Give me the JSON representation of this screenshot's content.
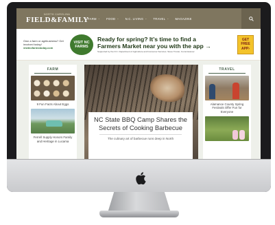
{
  "site": {
    "logo_top": "NORTH CAROLINA",
    "logo_main": "FIELD&FAMILY"
  },
  "nav": {
    "items": [
      {
        "label": "FARM",
        "caret": "⌄"
      },
      {
        "label": "FOOD",
        "caret": "⌄"
      },
      {
        "label": "N.C. LIVING",
        "caret": "⌄"
      },
      {
        "label": "TRAVEL",
        "caret": "⌄"
      },
      {
        "label": "MAGAZINE",
        "caret": ""
      }
    ],
    "search_icon": "search-icon"
  },
  "ad": {
    "left_text": "Own a farm or agribusiness? Get involved today!",
    "left_url": "visitncfarmstoday.com",
    "badge_line1": "VISIT NC",
    "badge_line2": "FARMS",
    "headline_line1": "Ready for spring? It’s time to find a",
    "headline_line2": "Farmers Market near you with the app →",
    "sub": "Supported by the N.C. Department of Agriculture and Consumer Services. Steve Troxler, Commissioner",
    "cta_line1": "GET",
    "cta_line2": "FREE",
    "cta_line3": "APP›"
  },
  "left_column": {
    "title": "FARM",
    "items": [
      {
        "caption": "9 Fun Facts About Eggs"
      },
      {
        "caption": "Ferrell Supply Honors Family and Heritage in Lucama"
      }
    ]
  },
  "hero": {
    "title": "NC State BBQ Camp Shares the Secrets of Cooking Barbecue",
    "excerpt": "The culinary art of barbecue runs deep in North"
  },
  "right_column": {
    "title": "TRAVEL",
    "items": [
      {
        "caption": "Alamance County Spring Festivals Offer Fun for Everyone"
      },
      {
        "caption": ""
      }
    ]
  },
  "colors": {
    "header": "#7f765f",
    "accent_green": "#46604a",
    "cta_yellow": "#f3c32b"
  }
}
